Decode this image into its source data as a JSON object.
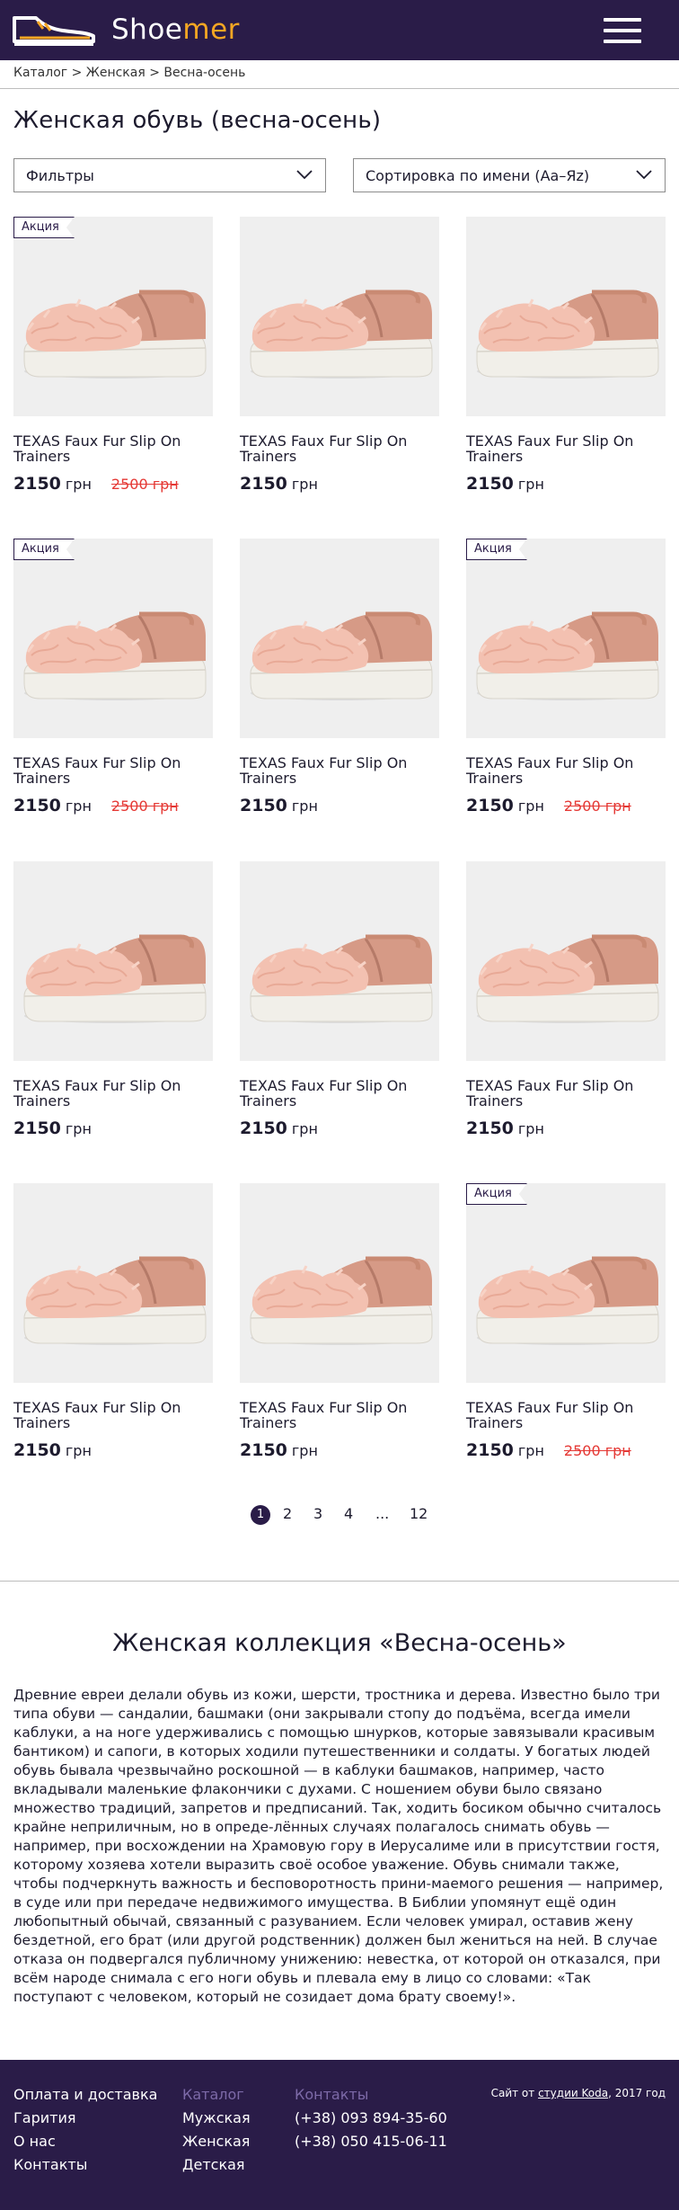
{
  "header": {
    "logo_part1": "Shoe",
    "logo_part2": "mer",
    "brand_color": "#2a1c48",
    "accent_color": "#f5a623"
  },
  "breadcrumb": {
    "text": "Каталог > Женская > Весна-осень"
  },
  "page_title": "Женская обувь (весна-осень)",
  "filters": {
    "filter_label": "Фильтры",
    "sort_label": "Сортировка по имени (Аа–Яz)"
  },
  "products": [
    {
      "name": "TEXAS Faux Fur Slip On Trainers",
      "price": "2150",
      "currency": "грн",
      "old_price": "2500 грн",
      "badge": "Акция"
    },
    {
      "name": "TEXAS Faux Fur Slip On Trainers",
      "price": "2150",
      "currency": "грн",
      "old_price": "",
      "badge": ""
    },
    {
      "name": "TEXAS Faux Fur Slip On Trainers",
      "price": "2150",
      "currency": "грн",
      "old_price": "",
      "badge": ""
    },
    {
      "name": "TEXAS Faux Fur Slip On Trainers",
      "price": "2150",
      "currency": "грн",
      "old_price": "2500 грн",
      "badge": "Акция"
    },
    {
      "name": "TEXAS Faux Fur Slip On Trainers",
      "price": "2150",
      "currency": "грн",
      "old_price": "",
      "badge": ""
    },
    {
      "name": "TEXAS Faux Fur Slip On Trainers",
      "price": "2150",
      "currency": "грн",
      "old_price": "2500 грн",
      "badge": "Акция"
    },
    {
      "name": "TEXAS Faux Fur Slip On Trainers",
      "price": "2150",
      "currency": "грн",
      "old_price": "",
      "badge": ""
    },
    {
      "name": "TEXAS Faux Fur Slip On Trainers",
      "price": "2150",
      "currency": "грн",
      "old_price": "",
      "badge": ""
    },
    {
      "name": "TEXAS Faux Fur Slip On Trainers",
      "price": "2150",
      "currency": "грн",
      "old_price": "",
      "badge": ""
    },
    {
      "name": "TEXAS Faux Fur Slip On Trainers",
      "price": "2150",
      "currency": "грн",
      "old_price": "",
      "badge": ""
    },
    {
      "name": "TEXAS Faux Fur Slip On Trainers",
      "price": "2150",
      "currency": "грн",
      "old_price": "",
      "badge": ""
    },
    {
      "name": "TEXAS Faux Fur Slip On Trainers",
      "price": "2150",
      "currency": "грн",
      "old_price": "2500 грн",
      "badge": "Акция"
    }
  ],
  "pagination": {
    "pages": [
      "1",
      "2",
      "3",
      "4",
      "...",
      "12"
    ],
    "current": "1"
  },
  "about": {
    "title": "Женская коллекция «Весна-осень»",
    "text": "Древние евреи делали обувь из кожи, шерсти, тростника и дерева. Известно было три типа обуви — сандалии, башмаки (они закрывали стопу до подъёма, всегда имели каблуки, а на ноге удерживались с помощью шнурков, которые завязывали красивым бантиком) и сапоги, в которых ходили путешественники и солдаты. У богатых людей обувь бывала чрезвычайно роскошной — в каблуки башмаков, например, часто вкладывали маленькие флакончики с духами. С ношением обуви было связано множество традиций, запретов и предписаний. Так, ходить босиком обычно считалось крайне неприличным, но в опреде-лённых случаях полагалось снимать обувь — например, при восхождении на Храмовую гору в Иерусалиме или в присутствии гостя, которому хозяева хотели выразить своё особое уважение. Обувь снимали также, чтобы подчеркнуть важность и бесповоротность прини-маемого решения — например, в суде или при передаче недвижимого имущества. В Библии упомянут ещё один любопытный обычай, связанный с разуванием. Если человек умирал, оставив жену бездетной, его брат (или другой родственник) должен был жениться на ней. В случае отказа он подвергался публичному унижению: невестка, от которой он отказался, при всём народе снимала с его ноги обувь и плевала ему в лицо со словами: «Так поступают с человеком, который не созидает дома брату своему!»."
  },
  "footer": {
    "col1": [
      "Оплата и доставка",
      "Гарития",
      "О нас",
      "Контакты"
    ],
    "col2_head": "Каталог",
    "col2": [
      "Мужская",
      "Женская",
      "Детская"
    ],
    "col3_head": "Контакты",
    "col3": [
      "(+38) 093 894-35-60",
      "(+38) 050 415-06-11"
    ],
    "credit_prefix": "Сайт от ",
    "credit_link": "студии Koda",
    "credit_suffix": ", 2017 год"
  }
}
